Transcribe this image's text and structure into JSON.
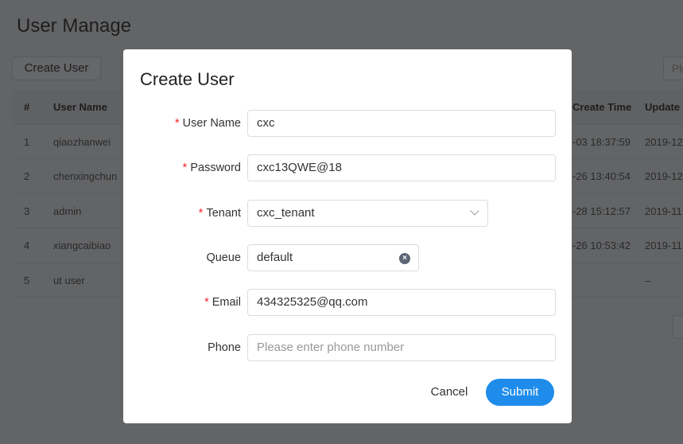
{
  "page": {
    "title": "User Manage",
    "create_button": "Create User",
    "search_placeholder": "Please enter keyword"
  },
  "table": {
    "headers": [
      "#",
      "User Name",
      "Create Time",
      "Update Time"
    ],
    "rows": [
      {
        "index": "1",
        "name": "qiaozhanwei",
        "create": "-03 18:37:59",
        "update": "2019-12"
      },
      {
        "index": "2",
        "name": "chenxingchun",
        "create": "-26 13:40:54",
        "update": "2019-12"
      },
      {
        "index": "3",
        "name": "admin",
        "create": "-28 15:12:57",
        "update": "2019-11"
      },
      {
        "index": "4",
        "name": "xiangcaibiao",
        "create": "-26 10:53:42",
        "update": "2019-11"
      },
      {
        "index": "5",
        "name": "ut user",
        "create": "",
        "update": "–"
      }
    ]
  },
  "modal": {
    "title": "Create User",
    "required_mark": "*",
    "fields": {
      "username": {
        "label": "User Name",
        "value": "cxc"
      },
      "password": {
        "label": "Password",
        "value": "cxc13QWE@18"
      },
      "tenant": {
        "label": "Tenant",
        "value": "cxc_tenant"
      },
      "queue": {
        "label": "Queue",
        "value": "default"
      },
      "email": {
        "label": "Email",
        "value": "434325325@qq.com"
      },
      "phone": {
        "label": "Phone",
        "value": "",
        "placeholder": "Please enter phone number"
      }
    },
    "cancel": "Cancel",
    "submit": "Submit"
  },
  "colors": {
    "primary": "#1f8ceb",
    "required": "#f5222d"
  }
}
